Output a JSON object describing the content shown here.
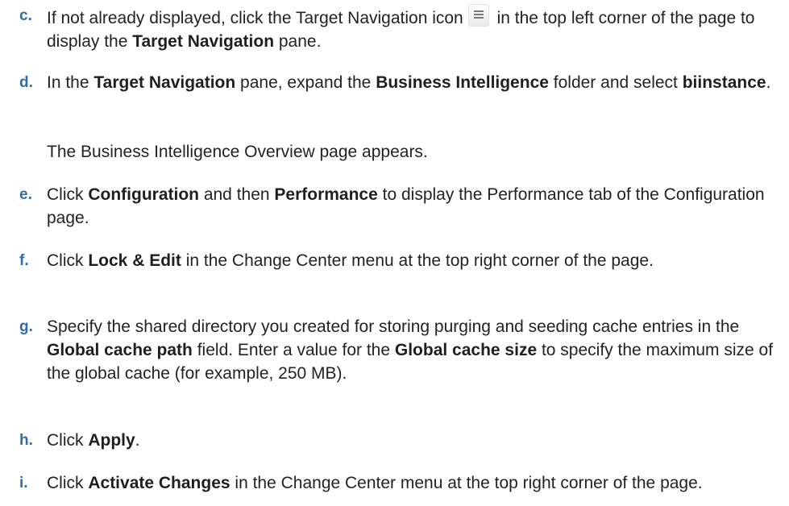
{
  "steps": [
    {
      "marker": "c.",
      "parts": [
        {
          "t": "If not already displayed, click the Target Navigation icon"
        },
        {
          "icon": "navigation-menu-icon"
        },
        {
          "t": " in the top left corner of the page to display the "
        },
        {
          "t": "Target Navigation",
          "b": true
        },
        {
          "t": " pane."
        }
      ]
    },
    {
      "marker": "d.",
      "parts": [
        {
          "t": "In the "
        },
        {
          "t": "Target Navigation",
          "b": true
        },
        {
          "t": " pane, expand the "
        },
        {
          "t": "Business Intelligence",
          "b": true
        },
        {
          "t": " folder and select "
        },
        {
          "t": "biinstance",
          "b": true
        },
        {
          "t": "."
        }
      ]
    },
    {
      "marker": "",
      "note": "The Business Intelligence Overview page appears."
    },
    {
      "marker": "e.",
      "parts": [
        {
          "t": "Click "
        },
        {
          "t": "Configuration",
          "b": true
        },
        {
          "t": " and then "
        },
        {
          "t": "Performance",
          "b": true
        },
        {
          "t": " to display the Performance tab of the Configuration page."
        }
      ]
    },
    {
      "marker": "f.",
      "parts": [
        {
          "t": "Click "
        },
        {
          "t": "Lock & Edit",
          "b": true
        },
        {
          "t": " in the Change Center menu at the top right corner of the page."
        }
      ]
    },
    {
      "marker": "g.",
      "parts": [
        {
          "t": "Specify the shared directory you created for storing purging and seeding cache entries in the "
        },
        {
          "t": "Global cache path",
          "b": true
        },
        {
          "t": " field. Enter a value for the "
        },
        {
          "t": "Global cache size",
          "b": true
        },
        {
          "t": " to specify the maximum size of the global cache (for example, 250 MB)."
        }
      ]
    },
    {
      "marker": "h.",
      "parts": [
        {
          "t": "Click "
        },
        {
          "t": "Apply",
          "b": true
        },
        {
          "t": "."
        }
      ]
    },
    {
      "marker": "i.",
      "parts": [
        {
          "t": "Click "
        },
        {
          "t": "Activate Changes",
          "b": true
        },
        {
          "t": " in the Change Center menu at the top right corner of the page."
        }
      ]
    }
  ]
}
